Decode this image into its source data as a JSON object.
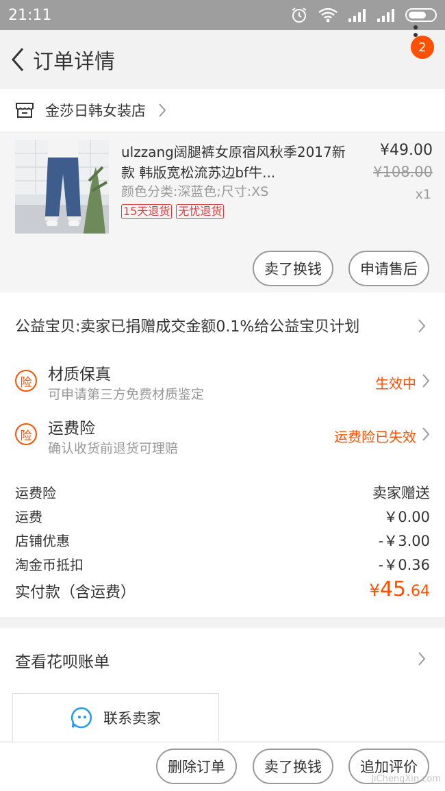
{
  "status_bar": {
    "time": "21:11"
  },
  "nav": {
    "title": "订单详情",
    "badge_count": "2"
  },
  "shop": {
    "name": "金莎日韩女装店"
  },
  "goods": {
    "title": "ulzzang阔腿裤女原宿风秋季2017新款 韩版宽松流苏边bf牛...",
    "sku": "颜色分类:深蓝色;尺寸:XS",
    "tags": [
      "15天退货",
      "无忧退货"
    ],
    "price": "¥49.00",
    "original_price": "¥108.00",
    "quantity": "x1",
    "btn_sell": "卖了换钱",
    "btn_aftersale": "申请售后"
  },
  "charity": {
    "text": "公益宝贝:卖家已捐赠成交金额0.1%给公益宝贝计划"
  },
  "insurance": [
    {
      "icon": "险",
      "title": "材质保真",
      "sub": "可申请第三方免费材质鉴定",
      "status": "生效中"
    },
    {
      "icon": "险",
      "title": "运费险",
      "sub": "确认收货前退货可理赔",
      "status": "运费险已失效"
    }
  ],
  "fees": [
    {
      "label": "运费险",
      "value": "卖家赠送"
    },
    {
      "label": "运费",
      "value": "￥0.00"
    },
    {
      "label": "店铺优惠",
      "value": "-￥3.00"
    },
    {
      "label": "淘金币抵扣",
      "value": "-￥0.36"
    }
  ],
  "total": {
    "label": "实付款（含运费）",
    "currency": "¥",
    "integer": "45",
    "decimal": ".64"
  },
  "huabei": {
    "label": "查看花呗账单"
  },
  "contact": {
    "label": "联系卖家"
  },
  "bottom": {
    "delete": "删除订单",
    "sell": "卖了换钱",
    "review": "追加评价"
  },
  "watermark": "JiChengXin.com",
  "colors": {
    "accent": "#ff5000",
    "tag_red": "#e4393c",
    "status_bar": "#9e9e9e"
  }
}
